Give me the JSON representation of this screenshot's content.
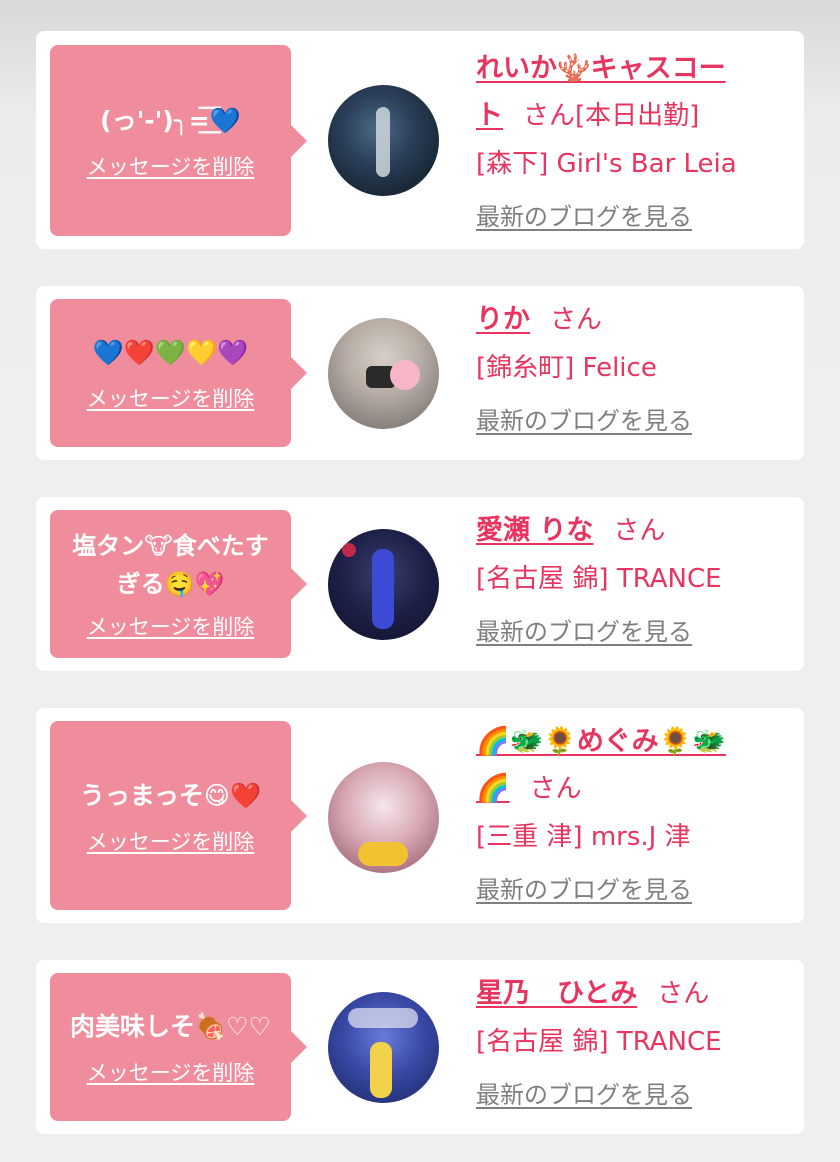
{
  "delete_label": "メッセージを削除",
  "san_label": "さん",
  "blog_label": "最新のブログを見る",
  "cards": [
    {
      "message": "(っ'-')╮=͟͟͞͞💙",
      "name_line1": "れいか🪸キャスコー",
      "name_line2": "ト",
      "shop": "[森下] Girl's Bar Leia"
    },
    {
      "message": "💙❤️💚💛💜",
      "name_line1": "りか",
      "shop": "[錦糸町] Felice"
    },
    {
      "message_line1": "塩タン🐮食べたす",
      "message_line2": "ぎる🤤💖",
      "name_line1": "愛瀬 りな",
      "shop": "[名古屋 錦] TRANCE"
    },
    {
      "message": "うっまっそ😋❤️",
      "name_line1": "🌈🐲🌻めぐみ🌻🐲",
      "name_line2": "🌈",
      "shop": "[三重 津] mrs.J 津"
    },
    {
      "message": "肉美味しそ🍖♡♡",
      "name_line1": "星乃　ひとみ",
      "shop": "[名古屋 錦] TRANCE"
    }
  ]
}
